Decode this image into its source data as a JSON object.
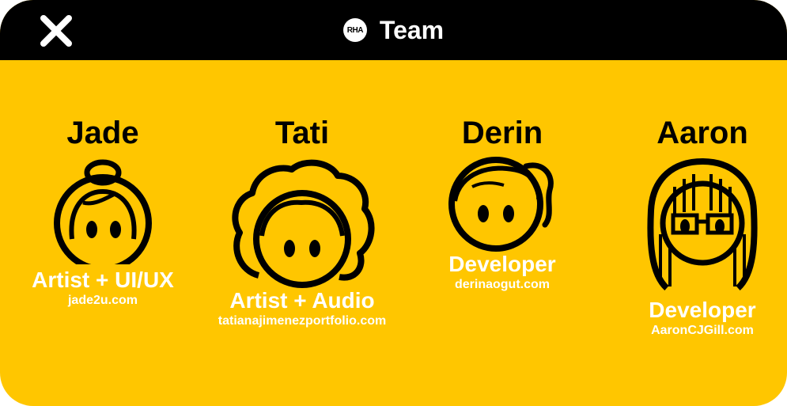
{
  "header": {
    "title": "Team",
    "logo_text": "RHA",
    "close_icon": "close-icon"
  },
  "colors": {
    "background": "#FFC600",
    "header": "#000000",
    "text_light": "#FFFFFF",
    "text_dark": "#000000"
  },
  "team": [
    {
      "name": "Jade",
      "role": "Artist + UI/UX",
      "site": "jade2u.com",
      "avatar_icon": "avatar-bun-hair-icon"
    },
    {
      "name": "Tati",
      "role": "Artist + Audio",
      "site": "tatianajimenezportfolio.com",
      "avatar_icon": "avatar-curly-hair-icon"
    },
    {
      "name": "Derin",
      "role": "Developer",
      "site": "derinaogut.com",
      "avatar_icon": "avatar-ponytail-icon"
    },
    {
      "name": "Aaron",
      "role": "Developer",
      "site": "AaronCJGill.com",
      "avatar_icon": "avatar-long-hair-glasses-icon"
    }
  ]
}
